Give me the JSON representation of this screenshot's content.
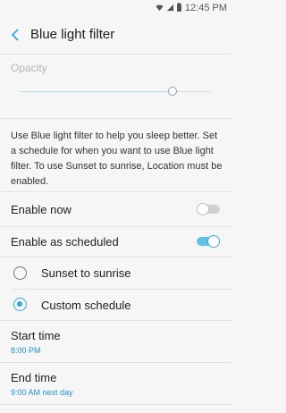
{
  "status_bar": {
    "time": "12:45 PM"
  },
  "header": {
    "title": "Blue light filter"
  },
  "opacity": {
    "label": "Opacity",
    "value_percent": 80
  },
  "description": "Use Blue light filter to help you sleep better. Set a schedule for when you want to use Blue light filter. To use Sunset to sunrise, Location must be enabled.",
  "settings": {
    "enable_now": {
      "label": "Enable now",
      "on": false
    },
    "enable_scheduled": {
      "label": "Enable as scheduled",
      "on": true
    }
  },
  "schedule_options": [
    {
      "label": "Sunset to sunrise",
      "selected": false
    },
    {
      "label": "Custom schedule",
      "selected": true
    }
  ],
  "times": {
    "start": {
      "label": "Start time",
      "value": "8:00 PM"
    },
    "end": {
      "label": "End time",
      "value": "9:00 AM next day"
    }
  },
  "colors": {
    "accent": "#36a9d9",
    "link": "#1c91c9"
  }
}
